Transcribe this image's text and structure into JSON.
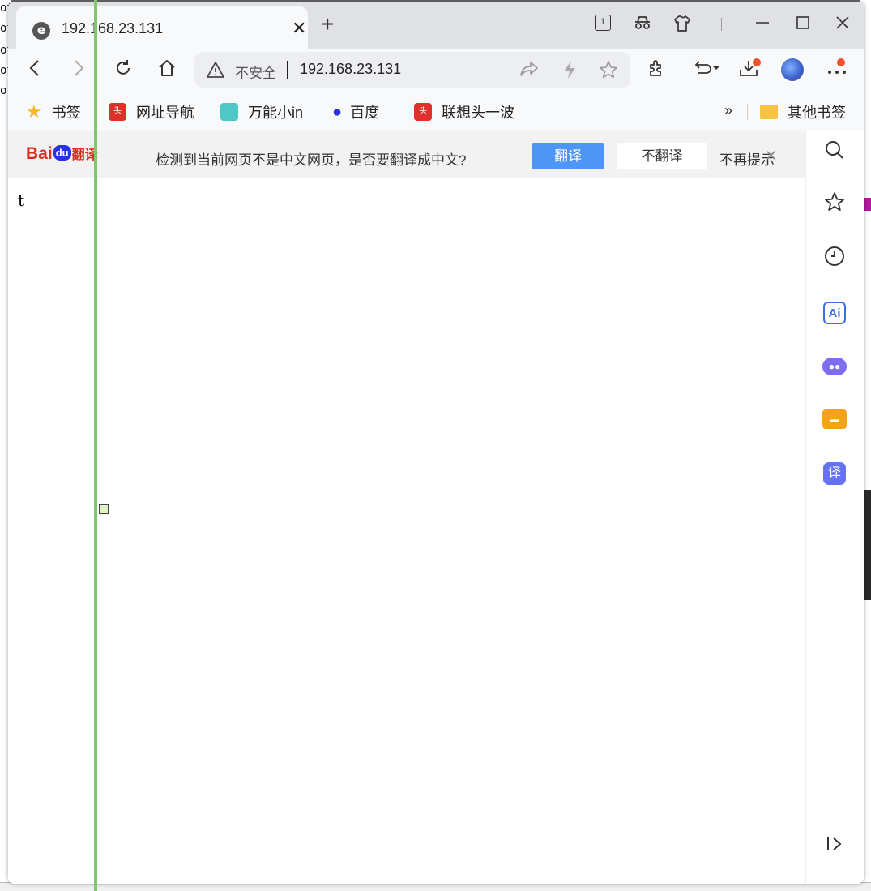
{
  "background": {
    "left_text": [
      "ot",
      "ot",
      "ot",
      "ot",
      "ot"
    ]
  },
  "window": {
    "tab": {
      "title": "192.168.23.131",
      "favicon": "e-browser-icon"
    },
    "new_tab_label": "+",
    "tab_count": "1",
    "toolbar": {
      "security_label": "不安全",
      "url": "192.168.23.131"
    },
    "bookmarks": {
      "items": [
        {
          "label": "书签",
          "icon": "star-icon"
        },
        {
          "label": "网址导航",
          "icon": "toutiao-icon"
        },
        {
          "label": "万能小in",
          "icon": "robot-icon"
        },
        {
          "label": "百度",
          "icon": "baidu-paw-icon"
        },
        {
          "label": "联想头一波",
          "icon": "toutiao-icon"
        }
      ],
      "more": "»",
      "other_folder": "其他书签"
    },
    "translate_bar": {
      "logo_bai": "Bai",
      "logo_du": "du",
      "logo_suffix": "翻译",
      "message": "检测到当前网页不是中文网页，是否要翻译成中文?",
      "translate_button": "翻译",
      "dont_translate_button": "不翻译",
      "never_prompt": "不再提示"
    },
    "page": {
      "text": "t"
    }
  },
  "colors": {
    "accent": "#4e96f6",
    "baidu_red": "#de2a1e",
    "baidu_blue": "#2932e1",
    "badge": "#f0502b",
    "overlay_green": "#7fc76a"
  }
}
